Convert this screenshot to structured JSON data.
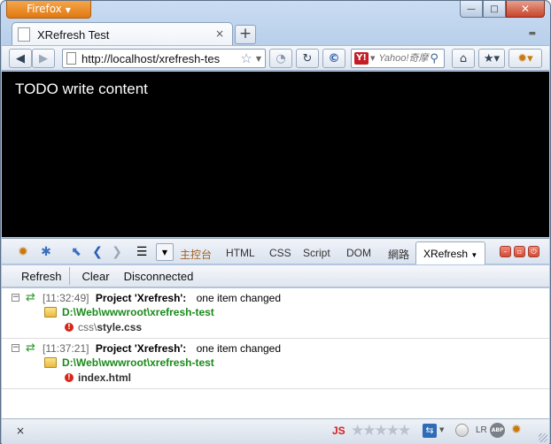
{
  "app": {
    "menu_button": "Firefox"
  },
  "window": {
    "minimize": "—",
    "maximize": "□",
    "close": "✕"
  },
  "tab": {
    "title": "XRefresh Test",
    "close": "×",
    "new_tab": "+"
  },
  "nav": {
    "url": "http://localhost/xrefresh-tes",
    "search_placeholder": "Yahoo!奇摩",
    "search_engine_icon": "yahoo-icon"
  },
  "page": {
    "content_text": "TODO write content"
  },
  "firebug": {
    "tabs": [
      "主控台",
      "HTML",
      "CSS",
      "Script",
      "DOM",
      "網路",
      "XRefresh"
    ],
    "active_tab": "XRefresh"
  },
  "xrefresh": {
    "buttons": {
      "refresh": "Refresh",
      "clear": "Clear",
      "status": "Disconnected"
    },
    "entries": [
      {
        "time": "[11:32:49]",
        "project": "Project 'Xrefresh':",
        "message": "one item changed",
        "path": "D:\\Web\\wwwroot\\xrefresh-test",
        "file_dir": "css\\",
        "file_name": "style.css"
      },
      {
        "time": "[11:37:21]",
        "project": "Project 'Xrefresh':",
        "message": "one item changed",
        "path": "D:\\Web\\wwwroot\\xrefresh-test",
        "file_dir": "",
        "file_name": "index.html"
      }
    ]
  },
  "statusbar": {
    "close": "×",
    "js": "JS",
    "lr": "LR",
    "abp": "ABP"
  },
  "colors": {
    "accent_orange": "#e07812",
    "path_green": "#1a8a1a",
    "error_red": "#d8261b"
  }
}
